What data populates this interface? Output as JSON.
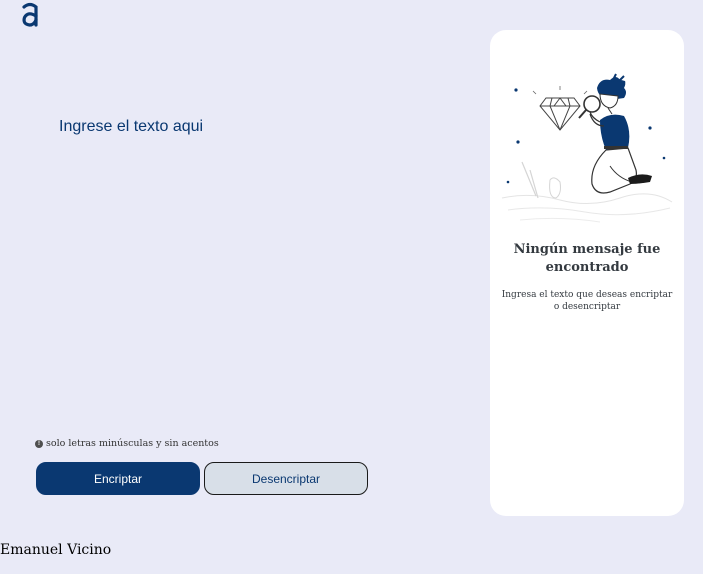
{
  "logo": {
    "icon": "alura-logo-icon",
    "color": "#0a3871"
  },
  "input": {
    "placeholder": "Ingrese el texto aqui",
    "value": ""
  },
  "hint": {
    "icon": "info-icon",
    "text": "solo letras minúsculas y sin acentos"
  },
  "buttons": {
    "encrypt_label": "Encriptar",
    "decrypt_label": "Desencriptar"
  },
  "output_panel": {
    "illustration": "person-magnifying-glass-diamond-illustration",
    "title": "Ningún mensaje fue encontrado",
    "subtitle": "Ingresa el texto que deseas encriptar o desencriptar"
  },
  "footer": {
    "author": "Emanuel Vicino"
  },
  "colors": {
    "background": "#e9eaf7",
    "primary": "#0a3871",
    "secondary_button": "#d8dfe8",
    "panel": "#ffffff"
  }
}
